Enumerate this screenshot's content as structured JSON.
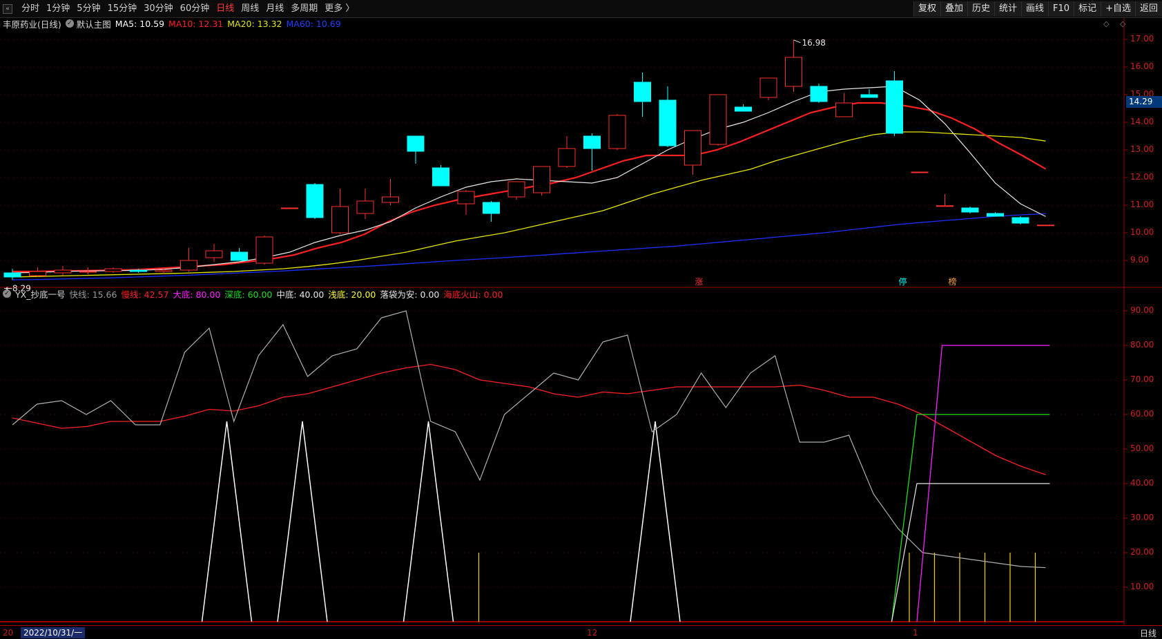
{
  "toolbar": {
    "arrow": "«",
    "periods": [
      {
        "label": "分时",
        "active": false
      },
      {
        "label": "1分钟",
        "active": false
      },
      {
        "label": "5分钟",
        "active": false
      },
      {
        "label": "15分钟",
        "active": false
      },
      {
        "label": "30分钟",
        "active": false
      },
      {
        "label": "60分钟",
        "active": false
      },
      {
        "label": "日线",
        "active": true
      },
      {
        "label": "周线",
        "active": false
      },
      {
        "label": "月线",
        "active": false
      },
      {
        "label": "多周期",
        "active": false
      },
      {
        "label": "更多 〉",
        "active": false
      }
    ],
    "right_tools": [
      "复权",
      "叠加",
      "历史",
      "统计",
      "画线",
      "F10",
      "标记",
      "+自选",
      "返回"
    ]
  },
  "price_legend": {
    "title": "丰原药业(日线)",
    "template": "默认主图",
    "ma5": "MA5: 10.59",
    "ma10": "MA10: 12.31",
    "ma20": "MA20: 13.32",
    "ma60": "MA60: 10.69",
    "colors": {
      "ma5": "#ffffff",
      "ma10": "#ff2020",
      "ma20": "#e6e600",
      "ma60": "#2030ff"
    }
  },
  "indicator_legend": {
    "title": "YX_抄底一号",
    "fast": "快线: 15.66",
    "slow": "慢线: 42.57",
    "big_bottom": "大底: 80.00",
    "deep_bottom": "深底: 60.00",
    "mid_bottom": "中底: 40.00",
    "shallow_bottom": "浅底: 20.00",
    "safe": "落袋为安: 0.00",
    "volcano": "海底火山: 0.00"
  },
  "price_axis": [
    "17.00",
    "16.00",
    "15.00",
    "14.00",
    "13.00",
    "12.00",
    "11.00",
    "10.00",
    "9.00"
  ],
  "last_price": "14.29",
  "indicator_axis": [
    "90.00",
    "80.00",
    "70.00",
    "60.00",
    "50.00",
    "40.00",
    "30.00",
    "20.00",
    "10.00"
  ],
  "annotations": {
    "high": "16.98",
    "low": "8.29",
    "markers": [
      "涨",
      "停",
      "榜"
    ]
  },
  "date_bar": {
    "cursor": "2022/10/31/一",
    "left_tick": "20",
    "mid_tick": "12",
    "right_tick": "1",
    "period": "日线"
  },
  "chart_data": {
    "type": "candlestick",
    "price_ylim": [
      8.0,
      17.3
    ],
    "indicator_ylim": [
      0,
      93
    ],
    "candles": [
      {
        "o": 8.55,
        "h": 8.7,
        "l": 8.29,
        "c": 8.4
      },
      {
        "o": 8.45,
        "h": 8.75,
        "l": 8.4,
        "c": 8.6
      },
      {
        "o": 8.55,
        "h": 8.8,
        "l": 8.45,
        "c": 8.65
      },
      {
        "o": 8.6,
        "h": 8.75,
        "l": 8.5,
        "c": 8.6
      },
      {
        "o": 8.6,
        "h": 8.75,
        "l": 8.55,
        "c": 8.7
      },
      {
        "o": 8.65,
        "h": 8.7,
        "l": 8.55,
        "c": 8.6
      },
      {
        "o": 8.6,
        "h": 8.7,
        "l": 8.5,
        "c": 8.65
      },
      {
        "o": 8.65,
        "h": 9.45,
        "l": 8.6,
        "c": 9.0
      },
      {
        "o": 9.1,
        "h": 9.6,
        "l": 8.95,
        "c": 9.35
      },
      {
        "o": 9.3,
        "h": 9.45,
        "l": 9.0,
        "c": 9.0
      },
      {
        "o": 8.9,
        "h": 9.9,
        "l": 8.85,
        "c": 9.85
      },
      {
        "o": 10.9,
        "h": 10.9,
        "l": 10.9,
        "c": 10.9
      },
      {
        "o": 11.75,
        "h": 11.8,
        "l": 10.5,
        "c": 10.55
      },
      {
        "o": 10.0,
        "h": 11.6,
        "l": 9.95,
        "c": 10.95
      },
      {
        "o": 10.7,
        "h": 11.6,
        "l": 10.5,
        "c": 11.15
      },
      {
        "o": 11.1,
        "h": 11.95,
        "l": 11.0,
        "c": 11.3
      },
      {
        "o": 13.5,
        "h": 13.5,
        "l": 12.5,
        "c": 12.95
      },
      {
        "o": 12.35,
        "h": 12.45,
        "l": 11.7,
        "c": 11.7
      },
      {
        "o": 11.05,
        "h": 11.55,
        "l": 10.65,
        "c": 11.5
      },
      {
        "o": 11.1,
        "h": 11.15,
        "l": 10.4,
        "c": 10.7
      },
      {
        "o": 11.3,
        "h": 11.85,
        "l": 11.2,
        "c": 11.85
      },
      {
        "o": 11.45,
        "h": 12.4,
        "l": 11.35,
        "c": 12.4
      },
      {
        "o": 12.4,
        "h": 13.5,
        "l": 12.35,
        "c": 13.05
      },
      {
        "o": 13.5,
        "h": 13.6,
        "l": 12.25,
        "c": 13.05
      },
      {
        "o": 13.05,
        "h": 14.3,
        "l": 13.0,
        "c": 14.25
      },
      {
        "o": 15.45,
        "h": 15.8,
        "l": 14.2,
        "c": 14.75
      },
      {
        "o": 14.8,
        "h": 15.3,
        "l": 13.1,
        "c": 13.15
      },
      {
        "o": 12.45,
        "h": 13.45,
        "l": 12.1,
        "c": 13.7
      },
      {
        "o": 13.2,
        "h": 15.0,
        "l": 13.15,
        "c": 15.0
      },
      {
        "o": 14.55,
        "h": 14.65,
        "l": 14.4,
        "c": 14.4
      },
      {
        "o": 14.9,
        "h": 15.4,
        "l": 14.8,
        "c": 15.6
      },
      {
        "o": 15.3,
        "h": 16.98,
        "l": 15.1,
        "c": 16.35
      },
      {
        "o": 15.3,
        "h": 15.4,
        "l": 14.7,
        "c": 14.75
      },
      {
        "o": 14.2,
        "h": 15.05,
        "l": 14.2,
        "c": 14.7
      },
      {
        "o": 15.0,
        "h": 15.2,
        "l": 14.9,
        "c": 14.9
      },
      {
        "o": 15.5,
        "h": 15.85,
        "l": 13.5,
        "c": 13.6
      },
      {
        "o": 12.2,
        "h": 12.2,
        "l": 12.2,
        "c": 12.2
      },
      {
        "o": 10.98,
        "h": 11.4,
        "l": 10.98,
        "c": 10.98
      },
      {
        "o": 10.9,
        "h": 10.95,
        "l": 10.7,
        "c": 10.75
      },
      {
        "o": 10.7,
        "h": 10.75,
        "l": 10.6,
        "c": 10.6
      },
      {
        "o": 10.55,
        "h": 10.6,
        "l": 10.3,
        "c": 10.35
      },
      {
        "o": 10.28,
        "h": 10.3,
        "l": 10.26,
        "c": 10.28
      }
    ],
    "ma5": [
      8.55,
      8.57,
      8.6,
      8.62,
      8.63,
      8.64,
      8.68,
      8.75,
      8.85,
      8.95,
      9.1,
      9.3,
      9.65,
      9.9,
      10.1,
      10.4,
      10.9,
      11.3,
      11.65,
      11.85,
      11.95,
      11.9,
      11.85,
      11.8,
      12.0,
      12.5,
      13.0,
      13.4,
      13.75,
      14.0,
      14.35,
      14.75,
      15.1,
      15.2,
      15.25,
      15.3,
      14.8,
      13.95,
      12.9,
      11.8,
      11.05,
      10.59
    ],
    "ma10": [
      8.6,
      8.6,
      8.62,
      8.63,
      8.64,
      8.66,
      8.7,
      8.75,
      8.8,
      8.85,
      8.95,
      9.05,
      9.2,
      9.45,
      9.65,
      9.95,
      10.4,
      10.75,
      11.0,
      11.2,
      11.35,
      11.5,
      11.65,
      11.8,
      12.0,
      12.3,
      12.6,
      12.8,
      12.8,
      12.8,
      13.0,
      13.3,
      13.65,
      14.0,
      14.35,
      14.55,
      14.7,
      14.7,
      14.6,
      14.45,
      14.15,
      13.75,
      13.25,
      12.8,
      12.31
    ],
    "ma20": [
      8.4,
      8.42,
      8.44,
      8.46,
      8.48,
      8.5,
      8.52,
      8.54,
      8.57,
      8.6,
      8.65,
      8.7,
      8.78,
      8.88,
      9.0,
      9.15,
      9.3,
      9.5,
      9.7,
      9.85,
      10.0,
      10.2,
      10.4,
      10.6,
      10.8,
      11.1,
      11.4,
      11.65,
      11.9,
      12.1,
      12.3,
      12.6,
      12.85,
      13.1,
      13.35,
      13.55,
      13.65,
      13.65,
      13.6,
      13.55,
      13.5,
      13.45,
      13.32
    ],
    "ma60": [
      8.3,
      8.31,
      8.33,
      8.35,
      8.37,
      8.4,
      8.43,
      8.46,
      8.5,
      8.54,
      8.58,
      8.62,
      8.67,
      8.72,
      8.77,
      8.82,
      8.88,
      8.94,
      9.0,
      9.05,
      9.1,
      9.16,
      9.22,
      9.28,
      9.34,
      9.4,
      9.46,
      9.52,
      9.6,
      9.68,
      9.76,
      9.84,
      9.92,
      10.0,
      10.1,
      10.2,
      10.3,
      10.38,
      10.45,
      10.52,
      10.6,
      10.65,
      10.69
    ],
    "fast_line": [
      57,
      63,
      64,
      60,
      64,
      57,
      57,
      78,
      85,
      58,
      77,
      86,
      71,
      77,
      79,
      88,
      90,
      58,
      55,
      41,
      60,
      66,
      72,
      70,
      81,
      83,
      55,
      60,
      72,
      62,
      72,
      77,
      52,
      52,
      54,
      37,
      27,
      20,
      19,
      18,
      17,
      16,
      15.66
    ],
    "slow_line": [
      59,
      57.5,
      56,
      56.5,
      58,
      58,
      58,
      59.5,
      61.5,
      61,
      62.5,
      65,
      66,
      68,
      70,
      72,
      73.5,
      74.5,
      73,
      70,
      69,
      68,
      66,
      65,
      66.5,
      66,
      67,
      68,
      68,
      68,
      68,
      68,
      68.5,
      67,
      65,
      65,
      63,
      60,
      56,
      52,
      48,
      45,
      42.57
    ],
    "white_spikes_x": [
      9,
      12,
      17,
      26
    ],
    "big_bottom": 80,
    "deep_bottom": 60,
    "mid_bottom": 40,
    "shallow_bottom": 20
  }
}
